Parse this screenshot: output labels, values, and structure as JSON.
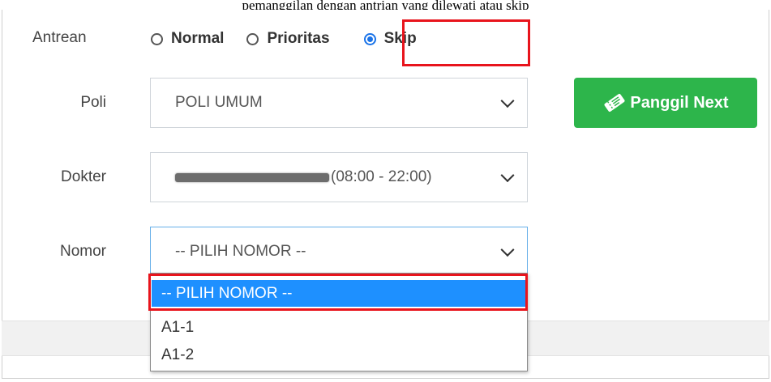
{
  "caption": "pemanggilan dengan antrian yang dilewati atau skip",
  "antrean": {
    "label": "Antrean",
    "options": [
      {
        "label": "Normal",
        "checked": false
      },
      {
        "label": "Prioritas",
        "checked": false
      },
      {
        "label": "Skip",
        "checked": true
      }
    ]
  },
  "poli": {
    "label": "Poli",
    "value": "POLI UMUM"
  },
  "dokter": {
    "label": "Dokter",
    "value_suffix": "(08:00 - 22:00)"
  },
  "nomor": {
    "label": "Nomor",
    "value": "-- PILIH NOMOR --",
    "options": [
      "-- PILIH NOMOR --",
      "A1-1",
      "A1-2"
    ]
  },
  "actions": {
    "next_label": "Panggil Next"
  },
  "colors": {
    "highlight": "#e8141c",
    "accent": "#1e90ff",
    "success": "#2db54b"
  },
  "icons": {
    "next_button": "ticket-icon"
  }
}
